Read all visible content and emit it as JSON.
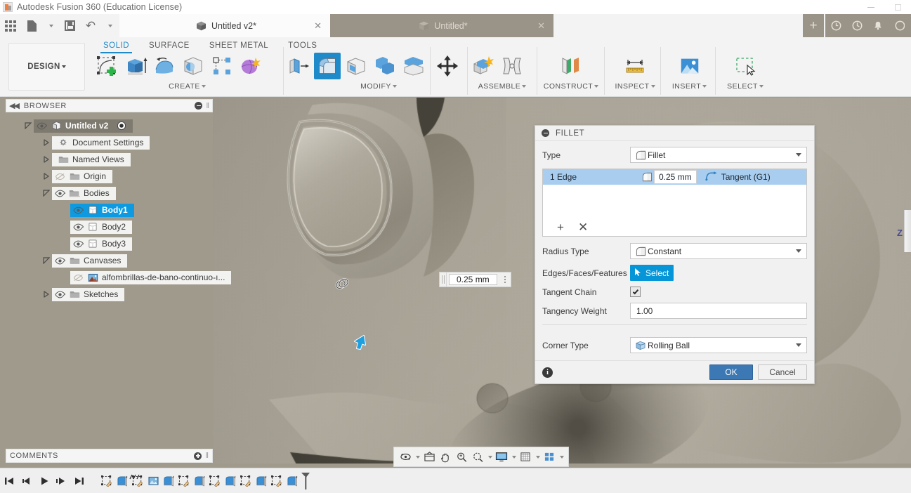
{
  "window": {
    "app_title": "Autodesk Fusion 360 (Education License)",
    "app_icon": "fusion-logo-icon",
    "minimize_icon": "minimize-icon",
    "maximize_icon": "maximize-icon"
  },
  "quick_access": {
    "items": [
      {
        "name": "app-grid-button",
        "icon": "grid-menu-icon",
        "label": ""
      },
      {
        "name": "new-document-button",
        "icon": "document-icon",
        "label": ""
      },
      {
        "name": "save-button",
        "icon": "save-disk-icon",
        "label": ""
      },
      {
        "name": "undo-button",
        "icon": "undo-arrow-icon",
        "label": ""
      },
      {
        "name": "redo-button",
        "icon": "redo-arrow-icon",
        "label": ""
      }
    ]
  },
  "tabs": {
    "active": {
      "label": "Untitled v2*",
      "icon": "cube-icon",
      "close": "✕"
    },
    "inactive": {
      "label": "Untitled*",
      "icon": "cube-icon",
      "close": "✕"
    },
    "new_tab": "+",
    "right_icons": [
      "job-status-icon",
      "history-clock-icon",
      "notification-bell-icon",
      "help-icon"
    ]
  },
  "design_menu": {
    "label": "DESIGN"
  },
  "ribbon": {
    "tabs": [
      {
        "label": "SOLID",
        "active": true
      },
      {
        "label": "SURFACE",
        "active": false
      },
      {
        "label": "SHEET METAL",
        "active": false
      },
      {
        "label": "TOOLS",
        "active": false
      }
    ],
    "panels": [
      {
        "label": "CREATE",
        "tools": [
          "create-sketch-icon",
          "extrude-icon",
          "revolve-icon",
          "sphere-icon",
          "pattern-icon",
          "form-icon"
        ]
      },
      {
        "label": "MODIFY",
        "tools": [
          "press-pull-icon",
          "fillet-icon",
          "shell-icon",
          "combine-icon",
          "split-body-icon"
        ]
      },
      {
        "label": "",
        "tools": [
          "move-copy-icon"
        ]
      },
      {
        "label": "ASSEMBLE",
        "tools": [
          "new-component-icon",
          "joint-icon"
        ]
      },
      {
        "label": "CONSTRUCT",
        "tools": [
          "offset-plane-icon"
        ]
      },
      {
        "label": "INSPECT",
        "tools": [
          "measure-icon"
        ]
      },
      {
        "label": "INSERT",
        "tools": [
          "insert-canvas-icon"
        ]
      },
      {
        "label": "SELECT",
        "tools": [
          "select-window-icon"
        ]
      }
    ]
  },
  "browser": {
    "title": "BROWSER",
    "collapse_icon": "collapse-left-icon",
    "minimize_icon": "minimize-circle-icon",
    "items": [
      {
        "label": "Untitled v2",
        "indent": 0,
        "expander": "expanded",
        "visibility": "eye-visible-icon",
        "icon": "component-cube-icon",
        "style": "dark",
        "trailing": "radio-active-icon"
      },
      {
        "label": "Document Settings",
        "indent": 1,
        "expander": "collapsed",
        "visibility": "",
        "icon": "gear-icon",
        "style": "light",
        "trailing": ""
      },
      {
        "label": "Named Views",
        "indent": 1,
        "expander": "collapsed",
        "visibility": "",
        "icon": "folder-icon",
        "style": "light",
        "trailing": ""
      },
      {
        "label": "Origin",
        "indent": 1,
        "expander": "collapsed",
        "visibility": "eye-hidden-icon",
        "icon": "folder-icon",
        "style": "light",
        "trailing": ""
      },
      {
        "label": "Bodies",
        "indent": 1,
        "expander": "expanded",
        "visibility": "eye-visible-icon",
        "icon": "folder-bodies-icon",
        "style": "light",
        "trailing": ""
      },
      {
        "label": "Body1",
        "indent": 2,
        "expander": "",
        "visibility": "eye-visible-icon",
        "icon": "body-icon",
        "style": "selected",
        "trailing": ""
      },
      {
        "label": "Body2",
        "indent": 2,
        "expander": "",
        "visibility": "eye-visible-icon",
        "icon": "body-icon",
        "style": "light",
        "trailing": ""
      },
      {
        "label": "Body3",
        "indent": 2,
        "expander": "",
        "visibility": "eye-visible-icon",
        "icon": "body-icon",
        "style": "light",
        "trailing": ""
      },
      {
        "label": "Canvases",
        "indent": 1,
        "expander": "expanded",
        "visibility": "eye-visible-icon",
        "icon": "folder-icon",
        "style": "light",
        "trailing": ""
      },
      {
        "label": "alfombrillas-de-bano-continuo-ı...",
        "indent": 2,
        "expander": "",
        "visibility": "eye-hidden-icon",
        "icon": "canvas-image-icon",
        "style": "light",
        "trailing": ""
      },
      {
        "label": "Sketches",
        "indent": 1,
        "expander": "collapsed",
        "visibility": "eye-visible-icon",
        "icon": "folder-icon",
        "style": "light",
        "trailing": ""
      }
    ]
  },
  "viewport": {
    "dimension_input": {
      "value": "0.25 mm",
      "drag_handle": "drag-grip-icon",
      "options": "more-options-icon"
    },
    "manipulator_arrow": "blue-cursor-arrow-icon",
    "chain_glyph": "tangent-chain-glyph-icon",
    "axis_label_z": "Z",
    "model_color": "#9d9689",
    "background_color": "#a8a294"
  },
  "nav_bar": {
    "items": [
      {
        "name": "orbit-icon",
        "has_caret": true
      },
      {
        "name": "look-at-icon",
        "has_caret": false
      },
      {
        "name": "pan-hand-icon",
        "has_caret": false
      },
      {
        "name": "zoom-icon",
        "has_caret": false
      },
      {
        "name": "fit-zoom-icon",
        "has_caret": true
      },
      {
        "name": "display-settings-icon",
        "has_caret": true
      },
      {
        "name": "grid-snaps-icon",
        "has_caret": true
      },
      {
        "name": "viewports-icon",
        "has_caret": true
      }
    ]
  },
  "comments": {
    "title": "COMMENTS",
    "add_icon": "add-comment-icon"
  },
  "timeline": {
    "nav": [
      "go-to-beginning-icon",
      "step-back-icon",
      "play-icon",
      "step-forward-icon",
      "go-to-end-icon"
    ],
    "features": [
      "sketch-icon",
      "extrude-icon",
      "sketch-icon",
      "canvas-icon",
      "extrude-icon",
      "sketch-icon",
      "extrude-icon",
      "sketch-icon",
      "extrude-icon",
      "sketch-icon",
      "extrude-icon",
      "sketch-icon",
      "extrude-icon"
    ],
    "end_marker": "timeline-marker-icon"
  },
  "fillet_dialog": {
    "title": "FILLET",
    "minimize_icon": "minimize-circle-icon",
    "type": {
      "label": "Type",
      "value": "Fillet",
      "icon": "fillet-small-icon"
    },
    "edge_row": {
      "name": "1 Edge",
      "radius_icon": "fillet-small-icon",
      "radius_value": "0.25 mm",
      "continuity_icon": "tangent-g1-icon",
      "continuity": "Tangent (G1)"
    },
    "list_tools": {
      "add": "+",
      "remove": "✕"
    },
    "radius_type": {
      "label": "Radius Type",
      "value": "Constant",
      "icon": "fillet-small-icon"
    },
    "edges_faces": {
      "label": "Edges/Faces/Features",
      "button": "Select",
      "icon": "cursor-arrow-icon"
    },
    "tangent_chain": {
      "label": "Tangent Chain",
      "checked": true
    },
    "tangency_weight": {
      "label": "Tangency Weight",
      "value": "1.00"
    },
    "corner_type": {
      "label": "Corner Type",
      "value": "Rolling Ball",
      "icon": "rolling-ball-icon"
    },
    "info_icon": "info-icon",
    "ok": "OK",
    "cancel": "Cancel",
    "accent_color": "#0696d7",
    "ok_color": "#3c78b4",
    "selection_color": "#a8cdef"
  }
}
